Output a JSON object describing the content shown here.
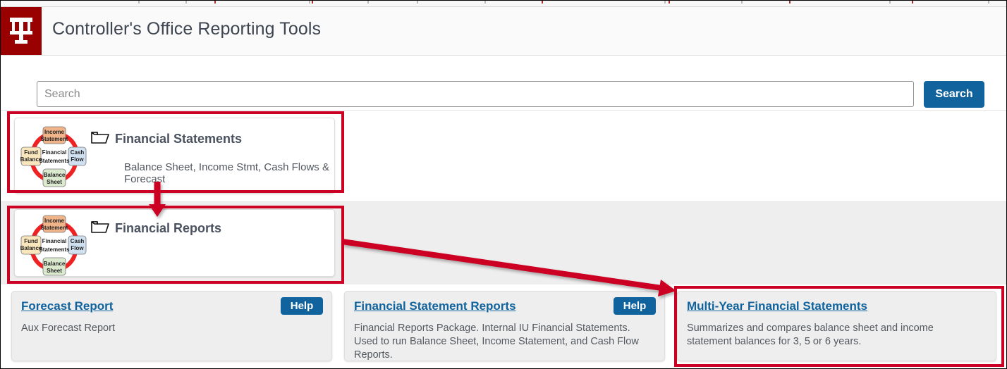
{
  "header": {
    "title": "Controller's Office Reporting Tools",
    "logo_name": "IU"
  },
  "search": {
    "placeholder": "Search",
    "value": "",
    "button_label": "Search"
  },
  "folders": [
    {
      "name": "Financial Statements",
      "description": "Balance Sheet, Income Stmt, Cash Flows & Forecast",
      "icon": "financial-statements-cycle-icon",
      "folder_icon": "folder-icon"
    },
    {
      "name": "Financial Reports",
      "description": "",
      "icon": "financial-statements-cycle-icon",
      "folder_icon": "folder-icon"
    }
  ],
  "cycle_diagram": {
    "center": "Financial Statements",
    "nodes": [
      {
        "label": "Income Statement",
        "position": "top",
        "color": "#f0b48a"
      },
      {
        "label": "Cash Flow",
        "position": "right",
        "color": "#cfe0f0"
      },
      {
        "label": "Balance Sheet",
        "position": "bottom",
        "color": "#dbe9cf"
      },
      {
        "label": "Fund Balance",
        "position": "left",
        "color": "#fae6bd"
      }
    ],
    "arrow_color": "#ee2222"
  },
  "reports": [
    {
      "title": "Forecast Report",
      "description": "Aux Forecast Report",
      "help_label": "Help",
      "has_help": true
    },
    {
      "title": "Financial Statement Reports",
      "description": "Financial Reports Package. Internal IU Financial Statements. Used to run Balance Sheet, Income Statement, and Cash Flow Reports.",
      "help_label": "Help",
      "has_help": true
    },
    {
      "title": "Multi-Year Financial Statements",
      "description": "Summarizes and compares balance sheet and income statement balances for 3, 5 or 6 years.",
      "help_label": "",
      "has_help": false
    }
  ],
  "annotations": {
    "boxes": [
      {
        "name": "highlight-financial-statements"
      },
      {
        "name": "highlight-financial-reports"
      },
      {
        "name": "highlight-multi-year-financial-statements"
      }
    ],
    "arrows": [
      {
        "name": "arrow-down-to-financial-reports"
      },
      {
        "name": "arrow-to-multi-year-financial-statements"
      }
    ],
    "color": "#cc0022"
  },
  "colors": {
    "brand_crimson": "#990000",
    "link_blue": "#11639e",
    "annotation_red": "#cc0022",
    "row_gray": "#eeeeee",
    "text_gray": "#4a5260"
  }
}
